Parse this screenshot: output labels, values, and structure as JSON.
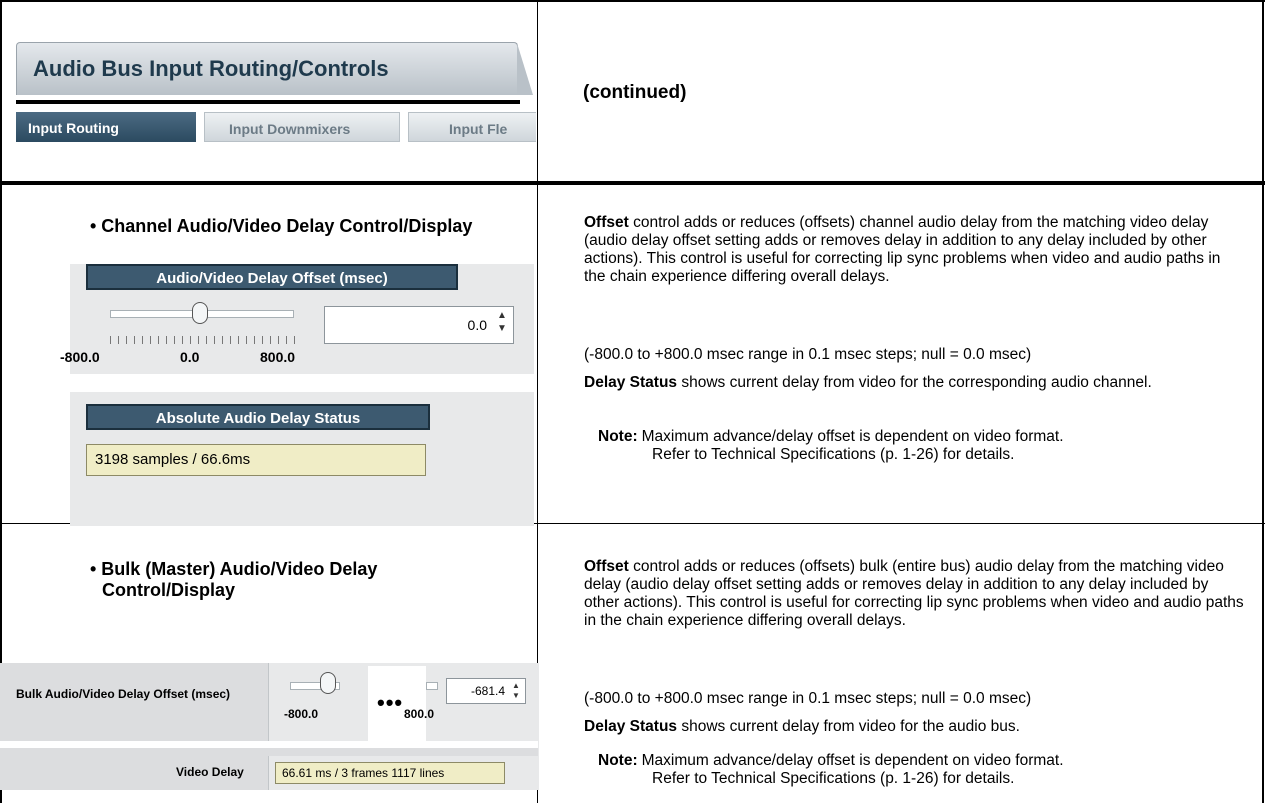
{
  "header": {
    "title": "Audio Bus Input Routing/Controls",
    "tabs": [
      {
        "label": "Input Routing",
        "active": true
      },
      {
        "label": "Input Downmixers",
        "active": false
      },
      {
        "label": "Input Fle",
        "active": false
      }
    ],
    "continued": "(continued)"
  },
  "section1": {
    "heading": "• Channel Audio/Video Delay Control/Display",
    "ui": {
      "offset_title": "Audio/Video Delay Offset (msec)",
      "slider_min": "-800.0",
      "slider_mid": "0.0",
      "slider_max": "800.0",
      "slider_value": 0.0,
      "spinner_value": "0.0",
      "status_title": "Absolute Audio Delay Status",
      "status_value": "3198 samples / 66.6ms"
    },
    "desc": {
      "p1_bold": "Offset",
      "p1": " control adds or reduces (offsets) channel audio delay from the matching video delay (audio delay offset setting adds or removes delay in addition to any delay included by other actions). This control is useful for correcting lip sync problems when video and audio paths in the chain experience differing overall delays.",
      "p2": "(-800.0 to +800.0 msec range in 0.1 msec steps; null = 0.0 msec)",
      "p3_bold": "Delay Status",
      "p3": " shows current delay from video for the corresponding audio channel.",
      "note_label": "Note:",
      "note_line1": "Maximum advance/delay offset is dependent on video format.",
      "note_line2": "Refer to Technical Specifications (p. 1-26) for details."
    }
  },
  "section2": {
    "heading_line1": "• Bulk (Master) Audio/Video Delay",
    "heading_line2": "Control/Display",
    "ui": {
      "offset_label": "Bulk Audio/Video Delay Offset (msec)",
      "slider_min": "-800.0",
      "slider_max": "800.0",
      "ellipsis": "•••",
      "spinner_value": "-681.4",
      "video_delay_label": "Video Delay",
      "video_delay_value": "66.61 ms / 3 frames 1117 lines"
    },
    "desc": {
      "p1_bold": "Offset",
      "p1": " control adds or reduces (offsets) bulk (entire bus) audio delay from the matching video delay (audio delay offset setting adds or removes delay in addition to any delay included by other actions). This control is useful for correcting lip sync problems when video and audio paths in the chain experience differing overall delays.",
      "p2": "(-800.0 to +800.0 msec range in 0.1 msec steps; null = 0.0 msec)",
      "p3_bold": "Delay Status",
      "p3": " shows current delay from video for the audio bus.",
      "note_label": "Note:",
      "note_line1": "Maximum advance/delay offset is dependent on video format.",
      "note_line2": "Refer to Technical Specifications (p. 1-26) for details."
    }
  },
  "colors": {
    "panel_title_bg": "#3d5a70",
    "status_bg": "#f0edc6",
    "tab_active_bg": "#2b4a60"
  }
}
